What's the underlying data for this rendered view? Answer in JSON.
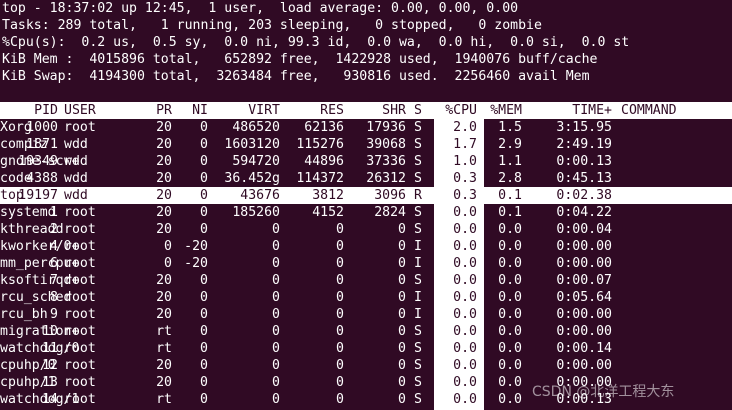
{
  "summary": {
    "uptime_line": "top - 18:37:02 up 12:45,  1 user,  load average: 0.00, 0.00, 0.00",
    "tasks_line": "Tasks: 289 total,   1 running, 203 sleeping,   0 stopped,   0 zombie",
    "cpu_line": "%Cpu(s):  0.2 us,  0.5 sy,  0.0 ni, 99.3 id,  0.0 wa,  0.0 hi,  0.0 si,  0.0 st",
    "mem_line": "KiB Mem :  4015896 total,   652892 free,  1422928 used,  1940076 buff/cache",
    "swap_line": "KiB Swap:  4194300 total,  3263484 free,   930816 used.  2256460 avail Mem"
  },
  "header": {
    "pid": "PID",
    "user": "USER",
    "pr": "PR",
    "ni": "NI",
    "virt": "VIRT",
    "res": "RES",
    "shr": "SHR",
    "s": "S",
    "cpu": "%CPU",
    "mem": "%MEM",
    "time": "TIME+",
    "command": "COMMAND"
  },
  "processes": [
    {
      "pid": "1000",
      "user": "root",
      "pr": "20",
      "ni": "0",
      "virt": "486520",
      "res": "62136",
      "shr": "17936",
      "s": "S",
      "cpu": "2.0",
      "mem": "1.5",
      "time": "3:15.95",
      "command": "Xorg"
    },
    {
      "pid": "1871",
      "user": "wdd",
      "pr": "20",
      "ni": "0",
      "virt": "1603120",
      "res": "115276",
      "shr": "39068",
      "s": "S",
      "cpu": "1.7",
      "mem": "2.9",
      "time": "2:49.19",
      "command": "compiz"
    },
    {
      "pid": "19349",
      "user": "wdd",
      "pr": "20",
      "ni": "0",
      "virt": "594720",
      "res": "44896",
      "shr": "37336",
      "s": "S",
      "cpu": "1.0",
      "mem": "1.1",
      "time": "0:00.13",
      "command": "gnome-scr+"
    },
    {
      "pid": "4388",
      "user": "wdd",
      "pr": "20",
      "ni": "0",
      "virt": "36.452g",
      "res": "114372",
      "shr": "26312",
      "s": "S",
      "cpu": "0.3",
      "mem": "2.8",
      "time": "0:45.13",
      "command": "code"
    },
    {
      "pid": "19197",
      "user": "wdd",
      "pr": "20",
      "ni": "0",
      "virt": "43676",
      "res": "3812",
      "shr": "3096",
      "s": "R",
      "cpu": "0.3",
      "mem": "0.1",
      "time": "0:02.38",
      "command": "top"
    },
    {
      "pid": "1",
      "user": "root",
      "pr": "20",
      "ni": "0",
      "virt": "185260",
      "res": "4152",
      "shr": "2824",
      "s": "S",
      "cpu": "0.0",
      "mem": "0.1",
      "time": "0:04.22",
      "command": "systemd"
    },
    {
      "pid": "2",
      "user": "root",
      "pr": "20",
      "ni": "0",
      "virt": "0",
      "res": "0",
      "shr": "0",
      "s": "S",
      "cpu": "0.0",
      "mem": "0.0",
      "time": "0:00.04",
      "command": "kthreadd"
    },
    {
      "pid": "4",
      "user": "root",
      "pr": "0",
      "ni": "-20",
      "virt": "0",
      "res": "0",
      "shr": "0",
      "s": "I",
      "cpu": "0.0",
      "mem": "0.0",
      "time": "0:00.00",
      "command": "kworker/0+"
    },
    {
      "pid": "6",
      "user": "root",
      "pr": "0",
      "ni": "-20",
      "virt": "0",
      "res": "0",
      "shr": "0",
      "s": "I",
      "cpu": "0.0",
      "mem": "0.0",
      "time": "0:00.00",
      "command": "mm_percpu+"
    },
    {
      "pid": "7",
      "user": "root",
      "pr": "20",
      "ni": "0",
      "virt": "0",
      "res": "0",
      "shr": "0",
      "s": "S",
      "cpu": "0.0",
      "mem": "0.0",
      "time": "0:00.07",
      "command": "ksoftirqd+"
    },
    {
      "pid": "8",
      "user": "root",
      "pr": "20",
      "ni": "0",
      "virt": "0",
      "res": "0",
      "shr": "0",
      "s": "I",
      "cpu": "0.0",
      "mem": "0.0",
      "time": "0:05.64",
      "command": "rcu_sched"
    },
    {
      "pid": "9",
      "user": "root",
      "pr": "20",
      "ni": "0",
      "virt": "0",
      "res": "0",
      "shr": "0",
      "s": "I",
      "cpu": "0.0",
      "mem": "0.0",
      "time": "0:00.00",
      "command": "rcu_bh"
    },
    {
      "pid": "10",
      "user": "root",
      "pr": "rt",
      "ni": "0",
      "virt": "0",
      "res": "0",
      "shr": "0",
      "s": "S",
      "cpu": "0.0",
      "mem": "0.0",
      "time": "0:00.00",
      "command": "migration+"
    },
    {
      "pid": "11",
      "user": "root",
      "pr": "rt",
      "ni": "0",
      "virt": "0",
      "res": "0",
      "shr": "0",
      "s": "S",
      "cpu": "0.0",
      "mem": "0.0",
      "time": "0:00.14",
      "command": "watchdog/0"
    },
    {
      "pid": "12",
      "user": "root",
      "pr": "20",
      "ni": "0",
      "virt": "0",
      "res": "0",
      "shr": "0",
      "s": "S",
      "cpu": "0.0",
      "mem": "0.0",
      "time": "0:00.00",
      "command": "cpuhp/0"
    },
    {
      "pid": "13",
      "user": "root",
      "pr": "20",
      "ni": "0",
      "virt": "0",
      "res": "0",
      "shr": "0",
      "s": "S",
      "cpu": "0.0",
      "mem": "0.0",
      "time": "0:00.00",
      "command": "cpuhp/1"
    },
    {
      "pid": "14",
      "user": "root",
      "pr": "rt",
      "ni": "0",
      "virt": "0",
      "res": "0",
      "shr": "0",
      "s": "S",
      "cpu": "0.0",
      "mem": "0.0",
      "time": "0:00.13",
      "command": "watchdog/1"
    }
  ],
  "highlighted_pid": "19197",
  "watermark": "CSDN @北洋工程大东",
  "colors": {
    "background": "#300a24",
    "foreground": "#ffffff",
    "highlight": "#ffffff"
  }
}
